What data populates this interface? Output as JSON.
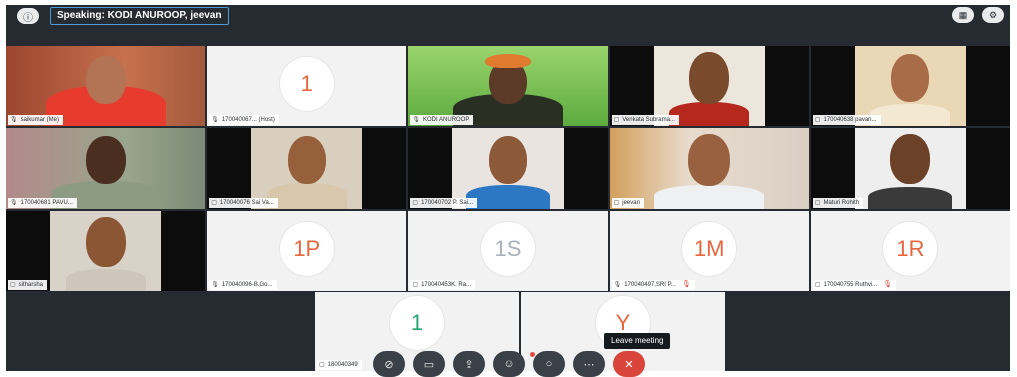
{
  "topbar": {
    "info_icon": "info-icon",
    "speaking": "Speaking:  KODI ANUROOP,  jeevan",
    "grid_icon": "grid-view-icon",
    "settings_icon": "settings-icon"
  },
  "tiles": [
    {
      "label": "saikumar (Me)",
      "type": "video"
    },
    {
      "label": "170040067... (Host)",
      "avatar": "1",
      "type": "avatar"
    },
    {
      "label": "KODI ANUROOP",
      "type": "video",
      "active": true
    },
    {
      "label": "Venkata Subrama...",
      "type": "video"
    },
    {
      "label": "170040638 pavan...",
      "type": "video"
    },
    {
      "label": "170040681 PAVU...",
      "type": "video"
    },
    {
      "label": "170040076 Sai Va...",
      "type": "video"
    },
    {
      "label": "170040702 P. Sai...",
      "type": "video"
    },
    {
      "label": "jeevan",
      "type": "video",
      "active": true
    },
    {
      "label": "Maturi Rohith",
      "type": "video"
    },
    {
      "label": "sitharsha",
      "type": "video"
    },
    {
      "label": "170040096-B.Go...",
      "avatar": "1P",
      "type": "avatar"
    },
    {
      "label": "170040453K. Ra...",
      "avatar": "1S",
      "type": "avatar",
      "color": "gray"
    },
    {
      "label": "170040497,SRI P...",
      "avatar": "1M",
      "type": "avatar",
      "muted": true
    },
    {
      "label": "170040755 Ruthvi...",
      "avatar": "1R",
      "type": "avatar",
      "muted": true
    }
  ],
  "bottom_tiles": [
    {
      "label": "180040349",
      "avatar": "1"
    },
    {
      "label": "",
      "avatar": "Y"
    }
  ],
  "controls": {
    "mic_icon": "mic-off-icon",
    "video_icon": "video-off-icon",
    "share_icon": "share-screen-icon",
    "participants_icon": "participants-icon",
    "chat_icon": "chat-icon",
    "more_icon": "more-icon",
    "leave_icon": "close-icon",
    "leave_tooltip": "Leave meeting"
  },
  "colors": {
    "background": "#262b31",
    "tile": "#f2f2f2",
    "active_border": "#4c9bd8",
    "leave": "#d9453b",
    "avatar_orange": "#e8663d",
    "avatar_green": "#2aa574"
  }
}
